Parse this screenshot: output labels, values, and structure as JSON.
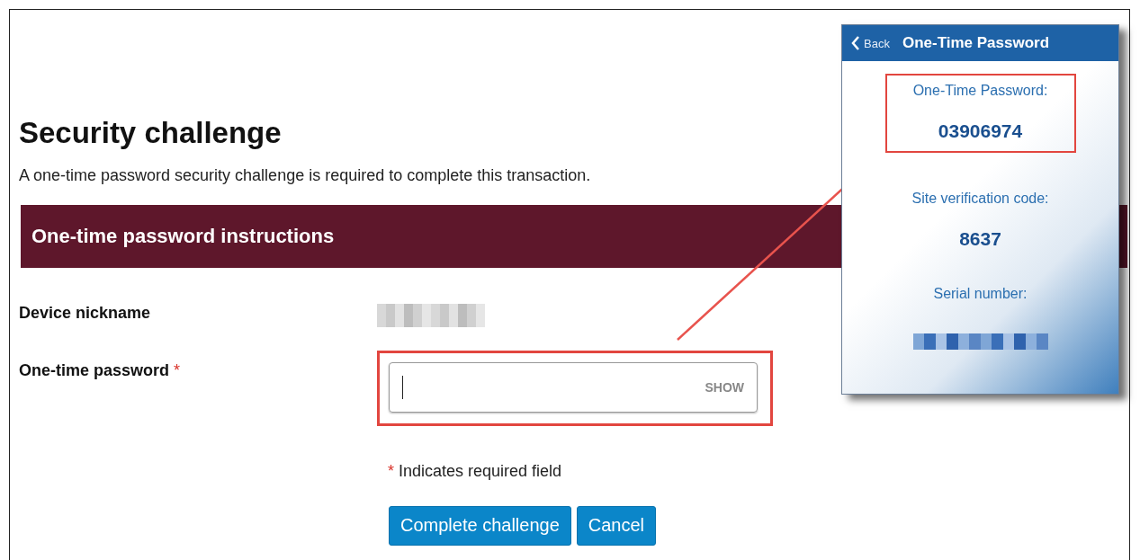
{
  "page": {
    "title": "Security challenge",
    "description": "A one-time password security challenge is required to complete this transaction.",
    "section_heading": "One-time password instructions",
    "fields": [
      {
        "label": "Device nickname",
        "kind": "redacted"
      },
      {
        "label": "One-time password",
        "required_mark": "*",
        "kind": "input",
        "action": "SHOW",
        "highlighted": true
      }
    ],
    "required_note": {
      "mark": "*",
      "text": "Indicates required field"
    },
    "buttons": [
      "Complete challenge",
      "Cancel"
    ]
  },
  "phone": {
    "back": "Back",
    "title": "One-Time Password",
    "items": [
      {
        "label": "One-Time Password:",
        "value": "03906974",
        "highlighted": true
      },
      {
        "label": "Site verification code:",
        "value": "8637",
        "highlighted": false
      },
      {
        "label": "Serial number:",
        "kind": "redacted",
        "highlighted": false
      }
    ]
  }
}
